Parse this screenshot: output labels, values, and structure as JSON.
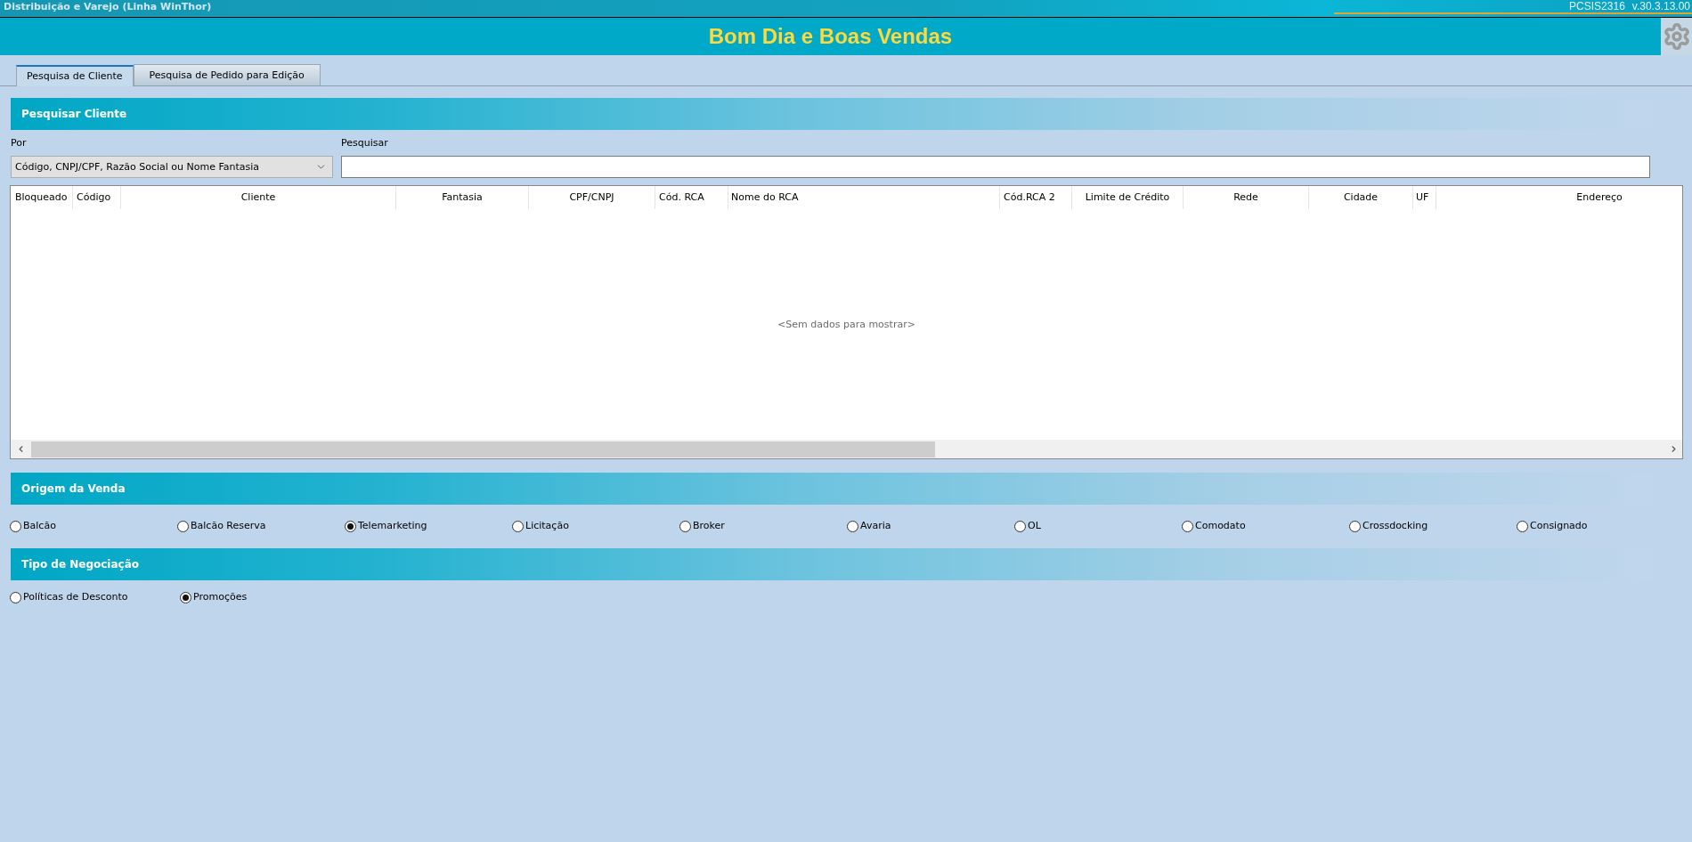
{
  "window": {
    "title": "Distribuição e Varejo (Linha WinThor)",
    "program": "PCSIS2316",
    "version": "v.30.3.13.00"
  },
  "banner": {
    "title": "Bom Dia e Boas Vendas"
  },
  "tabs": [
    {
      "label": "Pesquisa de Cliente",
      "selected": true
    },
    {
      "label": "Pesquisa de Pedido para Edição",
      "selected": false
    }
  ],
  "search_section": {
    "title": "Pesquisar Cliente",
    "by": {
      "label": "Por",
      "value": "Código, CNPJ/CPF, Razão Social ou Nome Fantasia"
    },
    "search": {
      "label": "Pesquisar"
    }
  },
  "table": {
    "columns": [
      "Bloqueado",
      "Código",
      "Cliente",
      "Fantasia",
      "CPF/CNPJ",
      "Cód. RCA",
      "Nome do RCA",
      "Cód.RCA 2",
      "Limite de Crédito",
      "Rede",
      "Cidade",
      "UF",
      "Endereço"
    ],
    "empty_message": "<Sem dados para mostrar>"
  },
  "sale_origin": {
    "title": "Origem da Venda",
    "options": [
      {
        "label": "Balcão",
        "selected": false
      },
      {
        "label": "Balcão Reserva",
        "selected": false
      },
      {
        "label": "Telemarketing",
        "selected": true
      },
      {
        "label": "Licitação",
        "selected": false
      },
      {
        "label": "Broker",
        "selected": false
      },
      {
        "label": "Avaria",
        "selected": false
      },
      {
        "label": "OL",
        "selected": false
      },
      {
        "label": "Comodato",
        "selected": false
      },
      {
        "label": "Crossdocking",
        "selected": false
      },
      {
        "label": "Consignado",
        "selected": false
      }
    ]
  },
  "negotiation_type": {
    "title": "Tipo de Negociação",
    "options": [
      {
        "label": "Políticas de Desconto",
        "selected": false
      },
      {
        "label": "Promoções",
        "selected": true
      }
    ]
  }
}
